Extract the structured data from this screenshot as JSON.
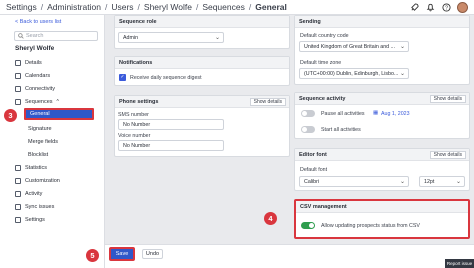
{
  "breadcrumb": [
    "Settings",
    "Administration",
    "Users",
    "Sheryl Wolfe",
    "Sequences",
    "General"
  ],
  "sidebar": {
    "back_label": "< Back to users list",
    "search_placeholder": "Search",
    "user_name": "Sheryl Wolfe",
    "items": [
      "Details",
      "Calendars",
      "Connectivity",
      "Sequences",
      "General",
      "Signature",
      "Merge fields",
      "Blocklist",
      "Statistics",
      "Customization",
      "Activity",
      "Sync issues",
      "Settings"
    ]
  },
  "sequence_role": {
    "title": "Sequence role",
    "value": "Admin"
  },
  "notifications": {
    "title": "Notifications",
    "checkbox_label": "Receive daily sequence digest",
    "checked": true
  },
  "phone_settings": {
    "title": "Phone settings",
    "show_details": "Show details",
    "sms_label": "SMS number",
    "sms_value": "No Number",
    "voice_label": "Voice number",
    "voice_value": "No Number"
  },
  "sending": {
    "title": "Sending",
    "country_label": "Default country code",
    "country_value": "United Kingdom of Great Britain and ...",
    "tz_label": "Default time zone",
    "tz_value": "(UTC+00:00) Dublin, Edinburgh, Lisbo..."
  },
  "sequence_activity": {
    "title": "Sequence activity",
    "show_details": "Show details",
    "pause_label": "Pause all activities",
    "pause_date": "Aug 1, 2023",
    "start_label": "Start all activities"
  },
  "editor_font": {
    "title": "Editor font",
    "show_details": "Show details",
    "font_label": "Default font",
    "font_value": "Calibri",
    "size_value": "12pt"
  },
  "csv_management": {
    "title": "CSV management",
    "toggle_label": "Allow updating prospects status from CSV",
    "enabled": true
  },
  "footer": {
    "save_label": "Save",
    "undo_label": "Undo",
    "report_label": "Report issue"
  },
  "callouts": {
    "three": "3",
    "four": "4",
    "five": "5"
  },
  "colors": {
    "primary": "#2f58c9",
    "highlight": "#d9363e",
    "toggle_on": "#2e9d4e"
  }
}
